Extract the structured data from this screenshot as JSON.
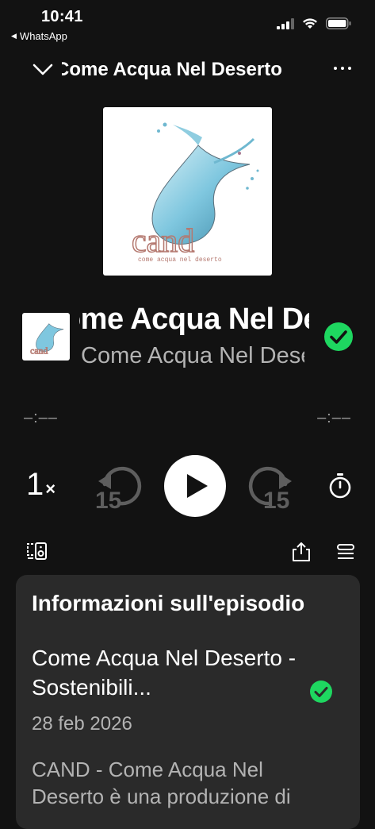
{
  "status_bar": {
    "time": "10:41",
    "back_app": "WhatsApp"
  },
  "header": {
    "title": "Come Acqua Nel Deserto",
    "icons": [
      "chevron-down-icon",
      "more-icon"
    ]
  },
  "artwork": {
    "logo_text": "cand",
    "tagline": "come acqua nel deserto"
  },
  "track": {
    "title": "Come Acqua Nel Deserto",
    "show": "Come Acqua Nel Deserto"
  },
  "progress": {
    "elapsed": "–:––",
    "remaining": "–:––"
  },
  "controls": {
    "speed": "1",
    "speed_suffix": "×",
    "skip_back": "15",
    "skip_forward": "15",
    "icons": [
      "play-icon",
      "rewind-15-icon",
      "forward-15-icon",
      "sleep-timer-icon"
    ]
  },
  "actions": {
    "icons": [
      "connect-device-icon",
      "share-icon",
      "queue-icon"
    ]
  },
  "info_card": {
    "heading": "Informazioni sull'episodio",
    "episode_title": "Come Acqua Nel Deserto - Sostenibili...",
    "date": "28 feb 2026",
    "description": "CAND - Come Acqua Nel Deserto è una produzione di"
  },
  "colors": {
    "background": "#121212",
    "card": "#2a2a2a",
    "accent_green": "#1ed760",
    "secondary_text": "#b3b3b3"
  }
}
